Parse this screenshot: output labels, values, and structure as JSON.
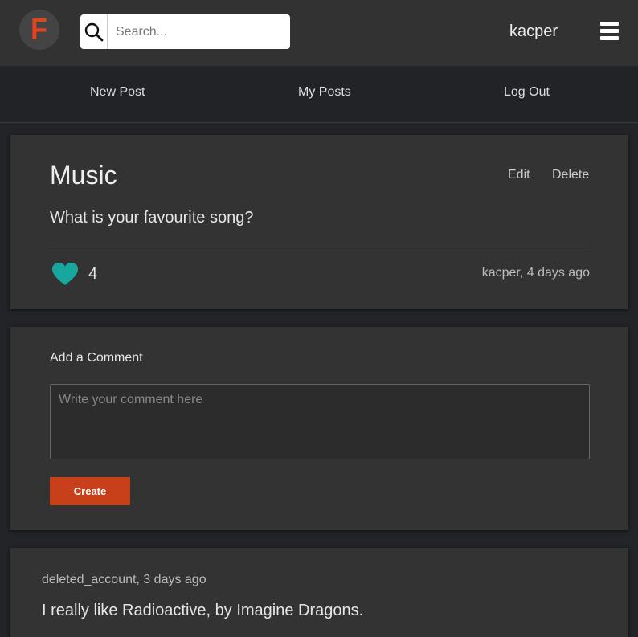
{
  "header": {
    "logo_letter": "F",
    "search_placeholder": "Search...",
    "username": "kacper"
  },
  "nav": {
    "new_post": "New Post",
    "my_posts": "My Posts",
    "log_out": "Log Out"
  },
  "post": {
    "title": "Music",
    "edit_label": "Edit",
    "delete_label": "Delete",
    "body": "What is your favourite song?",
    "likes": "4",
    "meta": "kacper, 4 days ago"
  },
  "comment_form": {
    "label": "Add a Comment",
    "placeholder": "Write your comment here",
    "button_label": "Create"
  },
  "comments": [
    {
      "meta": "deleted_account, 3 days ago",
      "text": "I really like Radioactive, by Imagine Dragons."
    }
  ],
  "colors": {
    "accent": "#c7401a",
    "logo": "#e2451d",
    "like": "#17a79d",
    "background": "#232428",
    "card": "#333333"
  },
  "icons": {
    "logo": "f-logo-icon",
    "search": "search-icon",
    "menu": "hamburger-menu-icon",
    "like": "heart-icon"
  }
}
